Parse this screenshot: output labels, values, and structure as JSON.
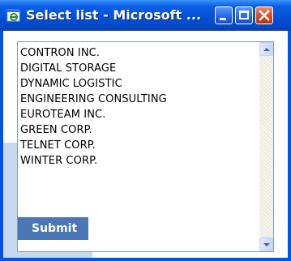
{
  "window": {
    "title": "Select list - Microsoft ...",
    "controls": {
      "minimize": "minimize-icon",
      "maximize": "maximize-icon",
      "close": "close-icon"
    }
  },
  "list": {
    "options": [
      "CONTRON INC.",
      "DIGITAL STORAGE",
      "DYNAMIC LOGISTIC",
      "ENGINEERING CONSULTING",
      "EUROTEAM INC.",
      "GREEN CORP.",
      "TELNET CORP.",
      "WINTER CORP."
    ]
  },
  "form": {
    "submit_label": "Submit"
  },
  "colors": {
    "titlebar": "#0451d6",
    "submit": "#4a76b4",
    "panel": "#c7d8ee"
  }
}
